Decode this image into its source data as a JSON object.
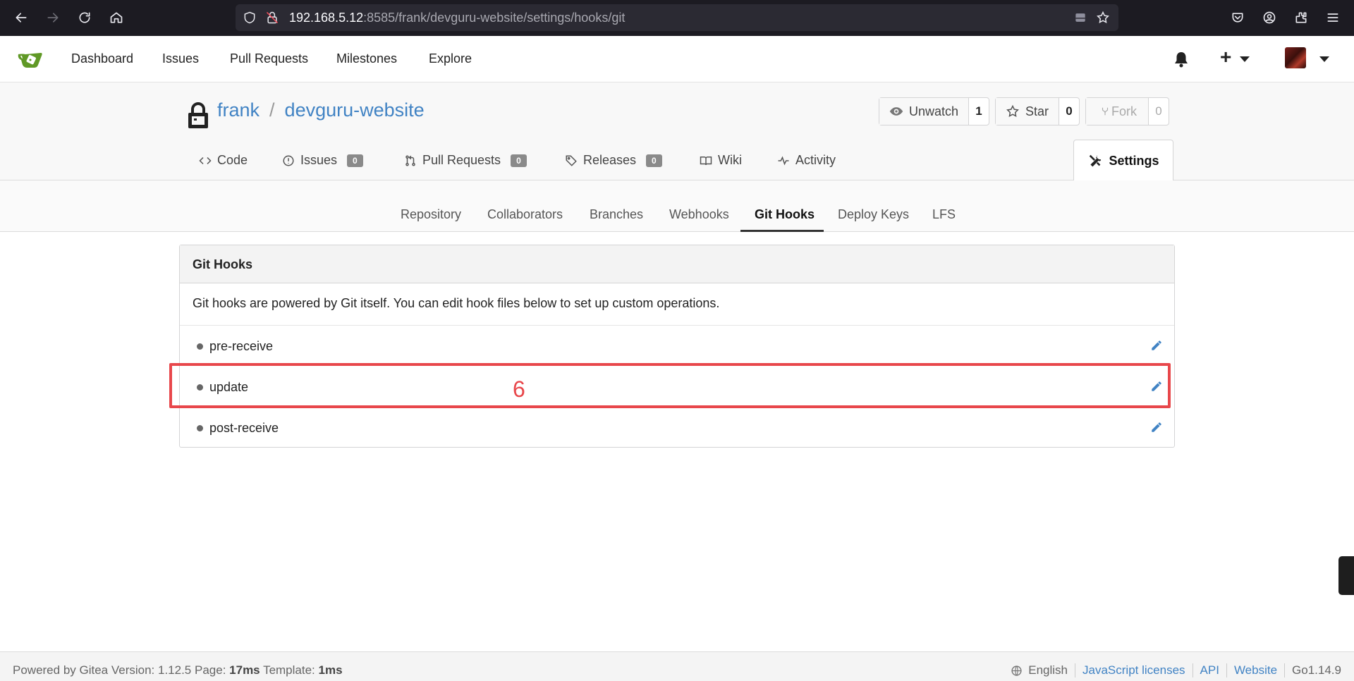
{
  "browser": {
    "url_host": "192.168.5.12",
    "url_rest": ":8585/frank/devguru-website/settings/hooks/git"
  },
  "header": {
    "nav": [
      "Dashboard",
      "Issues",
      "Pull Requests",
      "Milestones",
      "Explore"
    ],
    "plus": "+"
  },
  "repo": {
    "owner": "frank",
    "separator": "/",
    "name": "devguru-website",
    "unwatch_label": "Unwatch",
    "watch_count": "1",
    "star_label": "Star",
    "star_count": "0",
    "fork_label": "Fork",
    "fork_count": "0",
    "tabs": {
      "code": "Code",
      "issues": "Issues",
      "issues_count": "0",
      "pulls": "Pull Requests",
      "pulls_count": "0",
      "releases": "Releases",
      "releases_count": "0",
      "wiki": "Wiki",
      "activity": "Activity",
      "settings": "Settings"
    }
  },
  "settings_menu": {
    "items": [
      "Repository",
      "Collaborators",
      "Branches",
      "Webhooks",
      "Git Hooks",
      "Deploy Keys",
      "LFS"
    ],
    "active": "Git Hooks"
  },
  "git_hooks": {
    "title": "Git Hooks",
    "description": "Git hooks are powered by Git itself. You can edit hook files below to set up custom operations.",
    "hooks": [
      "pre-receive",
      "update",
      "post-receive"
    ]
  },
  "annotation": {
    "label": "6",
    "color": "#e8474b"
  },
  "footer": {
    "powered_by": "Powered by Gitea Version: 1.12.5 Page:",
    "page_time": "17ms",
    "template_label": "Template:",
    "template_time": "1ms",
    "language": "English",
    "js_licenses": "JavaScript licenses",
    "api": "API",
    "website": "Website",
    "go_version": "Go1.14.9"
  },
  "colors": {
    "link": "#4183c4",
    "browser_bg": "#1c1b22"
  }
}
